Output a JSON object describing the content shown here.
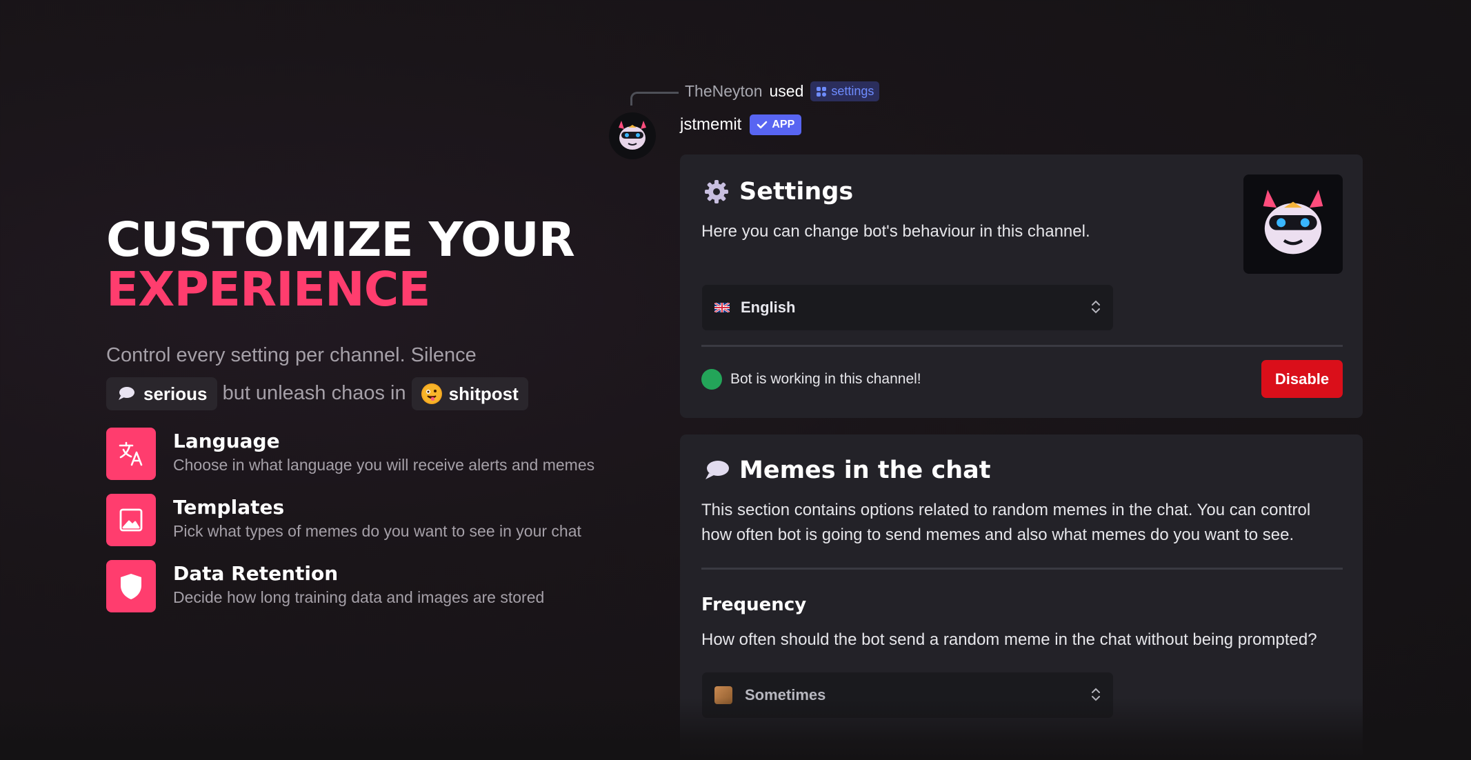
{
  "hero": {
    "title_line1": "CUSTOMIZE YOUR",
    "title_line2": "EXPERIENCE",
    "sub_text1": "Control every setting per channel. Silence",
    "chip_serious": "serious",
    "sub_text2": "but unleash chaos in",
    "chip_shitpost": "shitpost",
    "accent_color": "#ff3d6e"
  },
  "features": [
    {
      "icon": "translate-icon",
      "title": "Language",
      "desc": "Choose in what language you will receive alerts and memes"
    },
    {
      "icon": "image-icon",
      "title": "Templates",
      "desc": "Pick what types of memes do you want to see in your chat"
    },
    {
      "icon": "shield-icon",
      "title": "Data Retention",
      "desc": "Decide how long training data and images are stored"
    }
  ],
  "message": {
    "reply_user": "TheNeyton",
    "reply_used": "used",
    "command": "settings",
    "author": "jstmemit",
    "app_badge": "APP"
  },
  "settings_card": {
    "title": "Settings",
    "description": "Here you can change bot's behaviour in this channel.",
    "language_value": "English",
    "status_text": "Bot is working in this channel!",
    "disable_label": "Disable",
    "status_color": "#23a559",
    "disable_color": "#da0f1a"
  },
  "memes_card": {
    "title": "Memes in the chat",
    "description": "This section contains options related to random memes in the chat. You can control how often bot is going to send memes and also what memes do you want to see.",
    "frequency_title": "Frequency",
    "frequency_desc": "How often should the bot send a random meme in the chat without being prompted?",
    "frequency_value": "Sometimes"
  }
}
